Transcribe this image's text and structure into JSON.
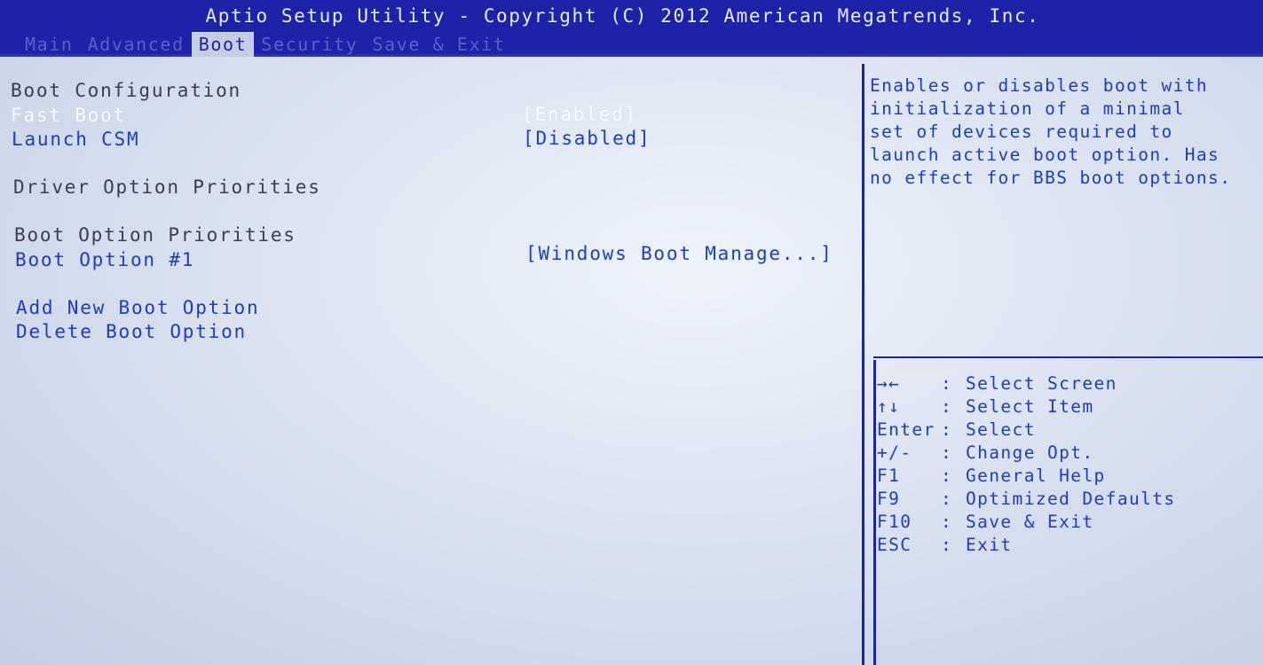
{
  "header": {
    "title": "Aptio Setup Utility - Copyright (C) 2012 American Megatrends, Inc.",
    "tabs": [
      {
        "label": "Main",
        "active": false
      },
      {
        "label": "Advanced",
        "active": false
      },
      {
        "label": "Boot",
        "active": true
      },
      {
        "label": "Security",
        "active": false
      },
      {
        "label": "Save & Exit",
        "active": false
      }
    ]
  },
  "main": {
    "boot_configuration_heading": "Boot Configuration",
    "fast_boot": {
      "label": "Fast Boot",
      "value": "[Enabled]"
    },
    "launch_csm": {
      "label": "Launch CSM",
      "value": "[Disabled]"
    },
    "driver_option_priorities_heading": "Driver Option Priorities",
    "boot_option_priorities_heading": "Boot Option Priorities",
    "boot_option_1": {
      "label": "Boot Option #1",
      "value": "[Windows Boot Manage...]"
    },
    "add_new_boot_option": "Add New Boot Option",
    "delete_boot_option": "Delete Boot Option"
  },
  "help": {
    "lines": [
      "Enables or disables boot with",
      "initialization of a minimal",
      "set of devices required to",
      "launch active boot option. Has",
      "no effect for BBS boot options."
    ]
  },
  "keys": [
    {
      "key": "→←",
      "sep": ":",
      "desc": "Select Screen"
    },
    {
      "key": "↑↓",
      "sep": ":",
      "desc": "Select Item"
    },
    {
      "key": "Enter",
      "sep": ":",
      "desc": "Select"
    },
    {
      "key": "+/-",
      "sep": ":",
      "desc": "Change Opt."
    },
    {
      "key": "F1",
      "sep": ":",
      "desc": "General Help"
    },
    {
      "key": "F9",
      "sep": ":",
      "desc": "Optimized Defaults"
    },
    {
      "key": "F10",
      "sep": ":",
      "desc": "Save & Exit"
    },
    {
      "key": "ESC",
      "sep": ":",
      "desc": "Exit"
    }
  ],
  "colors": {
    "header_bg": "#1d22a8",
    "active_tab_bg": "#c5cde0",
    "selectable_text": "#1d3cc4",
    "selected_text": "#ffffff",
    "heading_text": "#3b3e52"
  }
}
